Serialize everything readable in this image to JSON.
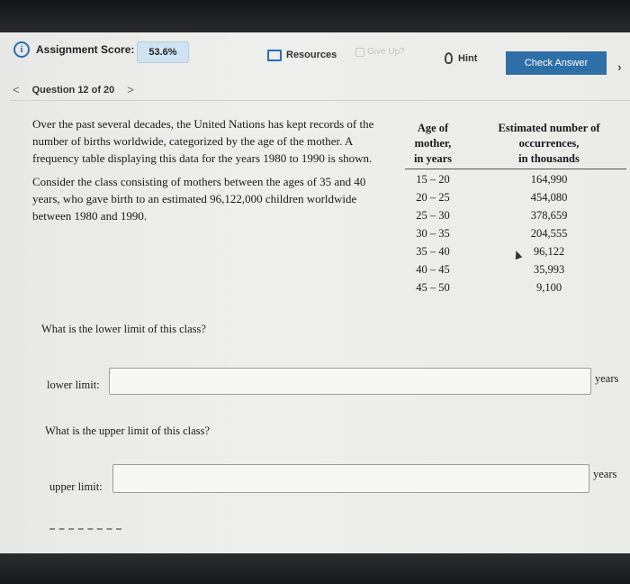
{
  "header": {
    "score_icon": "i",
    "score_label": "Assignment Score:",
    "score_value": "53.6%",
    "resources_label": "Resources",
    "giveup_label": "Give Up?",
    "hint_label": "Hint",
    "check_label": "Check Answer"
  },
  "nav": {
    "prev_icon": "<",
    "question_label": "Question 12 of 20",
    "next_icon": ">"
  },
  "problem": {
    "paragraph1": "Over the past several decades, the United Nations has kept records of the number of births worldwide, categorized by the age of the mother. A frequency table displaying this data for the years 1980 to 1990 is shown.",
    "paragraph2": "Consider the class consisting of mothers between the ages of 35 and 40 years, who gave birth to an estimated 96,122,000 children worldwide between 1980 and 1990."
  },
  "table": {
    "age_header": [
      "Age of",
      "mother,",
      "in years"
    ],
    "occ_header": [
      "Estimated number of",
      "occurrences,",
      "in thousands"
    ],
    "rows": [
      {
        "age": "15 – 20",
        "occ": "164,990"
      },
      {
        "age": "20 – 25",
        "occ": "454,080"
      },
      {
        "age": "25 – 30",
        "occ": "378,659"
      },
      {
        "age": "30 – 35",
        "occ": "204,555"
      },
      {
        "age": "35 – 40",
        "occ": "96,122"
      },
      {
        "age": "40 – 45",
        "occ": "35,993"
      },
      {
        "age": "45 – 50",
        "occ": "9,100"
      }
    ]
  },
  "questions": {
    "q1_text": "What is the lower limit of this class?",
    "q1_label": "lower limit:",
    "q1_value": "",
    "q1_unit": "years",
    "q2_text": "What is the upper limit of this class?",
    "q2_label": "upper limit:",
    "q2_value": "",
    "q2_unit": "years"
  }
}
